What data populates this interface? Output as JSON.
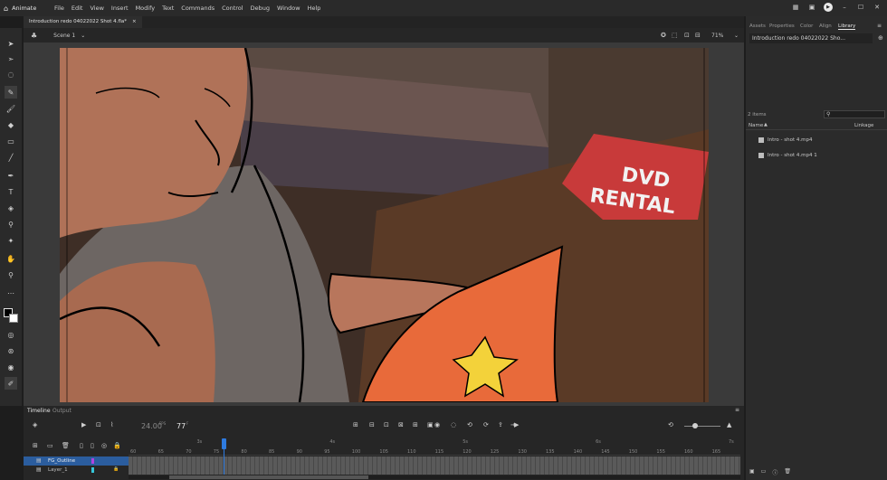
{
  "menubar": {
    "app_name": "Animate",
    "items": [
      "File",
      "Edit",
      "View",
      "Insert",
      "Modify",
      "Text",
      "Commands",
      "Control",
      "Debug",
      "Window",
      "Help"
    ]
  },
  "document": {
    "tab_title": "Introduction redo 04022022 Shot 4.fla*",
    "tab_close": "×"
  },
  "scene": {
    "label": "Scene 1",
    "zoom": "71%"
  },
  "right_panel": {
    "tabs": [
      "Assets",
      "Properties",
      "Color",
      "Align",
      "Library"
    ],
    "active_tab": "Library",
    "library_doc": "Introduction redo 04022022 Sho...",
    "item_count": "2 items",
    "col_name": "Name",
    "col_linkage": "Linkage",
    "items": [
      "Intro - shot 4.mp4",
      "Intro - shot 4.mp4 1"
    ]
  },
  "stage_art": {
    "box_text_1": "DVD",
    "box_text_2": "RENTAL"
  },
  "timeline": {
    "tabs": [
      "Timeline",
      "Output"
    ],
    "fps": "24.00",
    "fps_unit": "FPS",
    "current_frame": "77",
    "frame_unit": "F",
    "layers": [
      "FG_Outline",
      "Layer_1"
    ],
    "seconds_markers": [
      "3s",
      "4s",
      "5s",
      "6s",
      "7s"
    ],
    "frame_numbers": [
      "60",
      "65",
      "70",
      "75",
      "80",
      "85",
      "90",
      "95",
      "100",
      "105",
      "110",
      "115",
      "120",
      "125",
      "130",
      "135",
      "140",
      "145",
      "150",
      "155",
      "160",
      "165"
    ],
    "playhead_frame": 77
  },
  "colors": {
    "accent": "#2e7be0",
    "layer_highlight": "#2b5d9e",
    "panel_bg": "#2b2b2b"
  }
}
